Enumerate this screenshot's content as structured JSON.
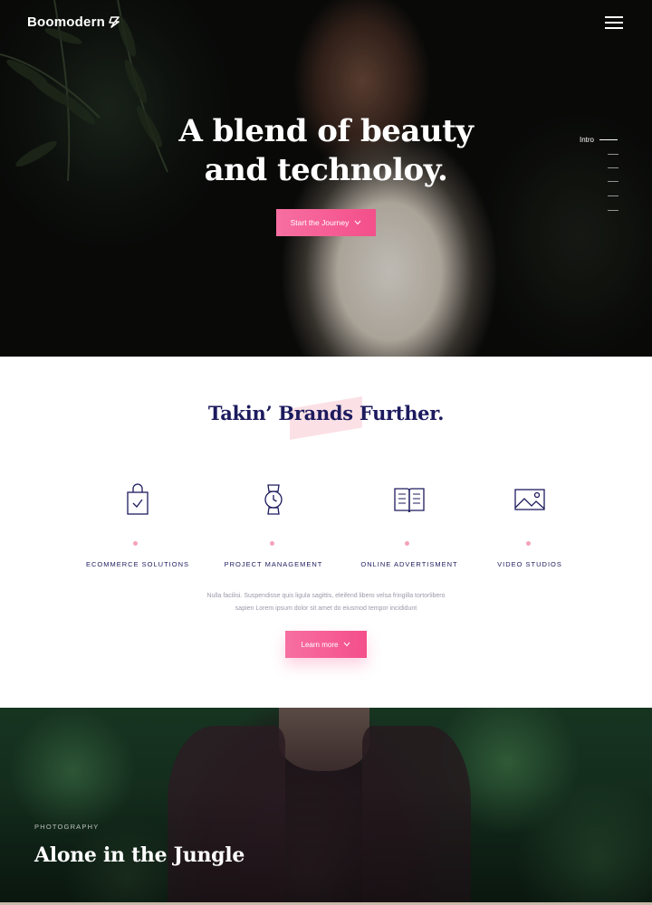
{
  "header": {
    "logo_text": "Boomodern",
    "logo_icon": "lightning-bolt-icon",
    "menu_icon": "hamburger-menu-icon"
  },
  "hero": {
    "title_line1": "A blend of beauty",
    "title_line2": "and technoloy.",
    "cta_label": "Start the Journey",
    "side_nav_label": "Intro"
  },
  "services": {
    "title": "Takin’ Brands Further.",
    "features": [
      {
        "label": "ECOMMERCE SOLUTIONS",
        "icon": "shopping-bag-icon"
      },
      {
        "label": "PROJECT MANAGEMENT",
        "icon": "watch-icon"
      },
      {
        "label": "ONLINE ADVERTISMENT",
        "icon": "open-book-icon"
      },
      {
        "label": "VIDEO STUDIOS",
        "icon": "image-icon"
      }
    ],
    "description_line1": "Nulla facilisi. Suspendisse quis ligula sagittis, eleifend libero velsa fringilla tortorlibero",
    "description_line2": "sapien Lorem ipsum dolor sit amet do eiusmod tempor incididunt",
    "cta_label": "Learn more"
  },
  "feature_block": {
    "kicker": "PHOTOGRAPHY",
    "title": "Alone in the Jungle"
  },
  "colors": {
    "accent_pink": "#f44f8a",
    "navy": "#1d1b5e",
    "dot_pink": "#f4a3b8"
  }
}
